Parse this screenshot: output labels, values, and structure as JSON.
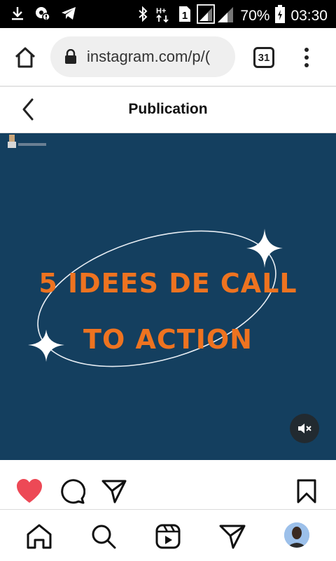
{
  "status_bar": {
    "battery": "70%",
    "time": "03:30",
    "sim_badge": "1",
    "network_badge": "H+"
  },
  "browser": {
    "url": "instagram.com/p/(",
    "tab_count": "31"
  },
  "header": {
    "title": "Publication"
  },
  "post": {
    "title_line_1": "5 IDEES DE CALL",
    "title_line_2": "TO ACTION",
    "liked": true,
    "colors": {
      "background": "#143f5f",
      "title": "#ee7320",
      "like": "#ed4956"
    }
  },
  "icons": {
    "status_left": [
      "download-icon",
      "location-settings-icon",
      "telegram-icon"
    ],
    "status_right": [
      "bluetooth-icon",
      "network-type-icon",
      "sim-icon",
      "signal-icon",
      "battery-icon"
    ],
    "actions": [
      "heart-icon",
      "comment-icon",
      "share-icon",
      "bookmark-icon"
    ],
    "nav": [
      "home-icon",
      "search-icon",
      "reels-icon",
      "direct-icon",
      "profile-avatar"
    ]
  }
}
